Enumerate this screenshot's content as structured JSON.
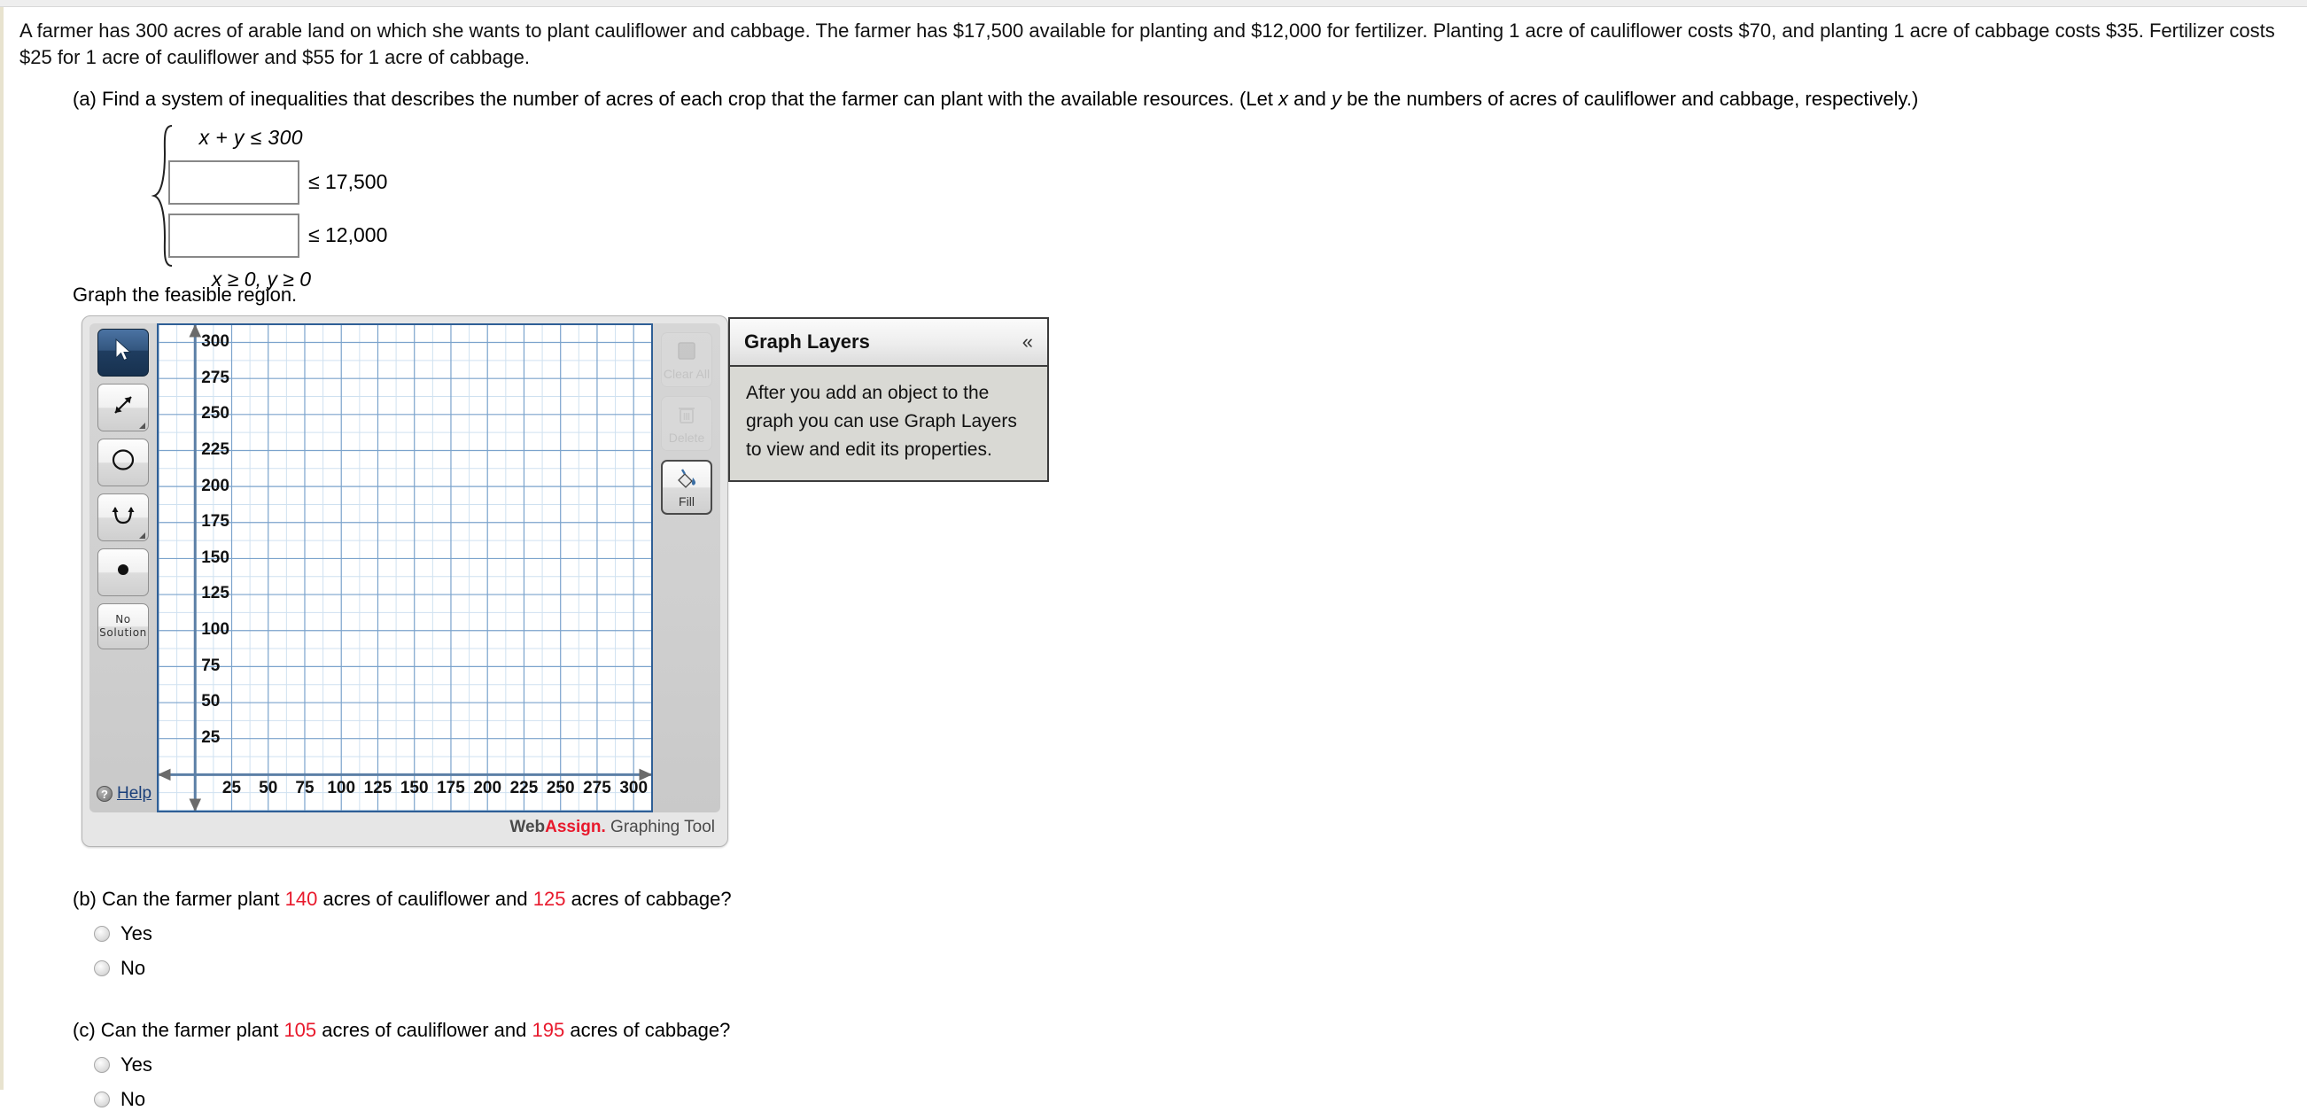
{
  "problem": {
    "statement": "A farmer has 300 acres of arable land on which she wants to plant cauliflower and cabbage. The farmer has $17,500 available for planting and $12,000 for fertilizer. Planting 1 acre of cauliflower costs $70, and planting 1 acre of cabbage costs $35. Fertilizer costs $25 for 1 acre of cauliflower and $55 for 1 acre of cabbage."
  },
  "part_a": {
    "prompt_1": "(a) Find a system of inequalities that describes the number of acres of each crop that the farmer can plant with the available resources. (Let ",
    "var_x": "x",
    "prompt_2": " and ",
    "var_y": "y",
    "prompt_3": " be the numbers of acres of cauliflower and cabbage, respectively.)",
    "system": {
      "row1": "x + y ≤ 300",
      "row2_value": "",
      "row2_placeholder": "",
      "row2_rhs": "≤ 17,500",
      "row3_value": "",
      "row3_placeholder": "",
      "row3_rhs": "≤ 12,000",
      "row4": "x ≥ 0,   y ≥ 0"
    }
  },
  "graph_prompt": "Graph the feasible region.",
  "graph_tool": {
    "left_tools": [
      {
        "name": "pointer-tool",
        "icon": "pointer-icon",
        "selected": true,
        "has_dropdown": false,
        "label": ""
      },
      {
        "name": "line-tool",
        "icon": "line-segment-icon",
        "selected": false,
        "has_dropdown": true,
        "label": ""
      },
      {
        "name": "circle-tool",
        "icon": "circle-icon",
        "selected": false,
        "has_dropdown": false,
        "label": ""
      },
      {
        "name": "parabola-tool",
        "icon": "parabola-icon",
        "selected": false,
        "has_dropdown": true,
        "label": ""
      },
      {
        "name": "point-tool",
        "icon": "dot-icon",
        "selected": false,
        "has_dropdown": false,
        "label": ""
      },
      {
        "name": "no-solution-tool",
        "icon": "text-icon",
        "selected": false,
        "has_dropdown": false,
        "label": "No\nSolution"
      }
    ],
    "no_solution_line1": "No",
    "no_solution_line2": "Solution",
    "help_label": "Help",
    "help_icon_glyph": "?",
    "right_tools": [
      {
        "name": "clear-all-button",
        "label": "Clear All",
        "icon": "square-icon",
        "enabled": false
      },
      {
        "name": "delete-button",
        "label": "Delete",
        "icon": "trash-icon",
        "enabled": false
      },
      {
        "name": "fill-button",
        "label": "Fill",
        "icon": "paint-bucket-icon",
        "enabled": true
      }
    ],
    "footer": {
      "web": "Web",
      "assign": "Assign.",
      "tool": " Graphing Tool"
    }
  },
  "chart_data": {
    "type": "scatter",
    "title": "",
    "xlabel": "",
    "ylabel": "",
    "xlim": [
      -25,
      312
    ],
    "ylim": [
      -25,
      312
    ],
    "x_ticks": [
      25,
      50,
      75,
      100,
      125,
      150,
      175,
      200,
      225,
      250,
      275,
      300
    ],
    "y_ticks": [
      25,
      50,
      75,
      100,
      125,
      150,
      175,
      200,
      225,
      250,
      275,
      300
    ],
    "major_step": 25,
    "minor_step": 12.5,
    "grid": true,
    "legend": "none",
    "series": [],
    "grid_major_color": "#7ba3cc",
    "grid_minor_color": "#cfe1f0",
    "axis_color": "#5b7fa6",
    "border_color": "#2f5f96",
    "background": "#ffffff"
  },
  "graph_layers": {
    "title": "Graph Layers",
    "collapse_glyph": "«",
    "body": "After you add an object to the graph you can use Graph Layers to view and edit its properties."
  },
  "part_b": {
    "prefix": "(b) Can the farmer plant ",
    "value_1": "140",
    "mid": " acres of cauliflower and ",
    "value_2": "125",
    "suffix": " acres of cabbage?",
    "options": [
      {
        "name": "radio-yes",
        "label": "Yes",
        "selected": false
      },
      {
        "name": "radio-no",
        "label": "No",
        "selected": false
      }
    ]
  },
  "part_c": {
    "prefix": "(c) Can the farmer plant ",
    "value_1": "105",
    "mid": " acres of cauliflower and ",
    "value_2": "195",
    "suffix": " acres of cabbage?",
    "options": [
      {
        "name": "radio-yes",
        "label": "Yes",
        "selected": false
      },
      {
        "name": "radio-no",
        "label": "No",
        "selected": false
      }
    ]
  },
  "colors": {
    "red_value": "#e8192c",
    "link_blue": "#1a3f7a",
    "selected_tool": "#1f3d60"
  }
}
